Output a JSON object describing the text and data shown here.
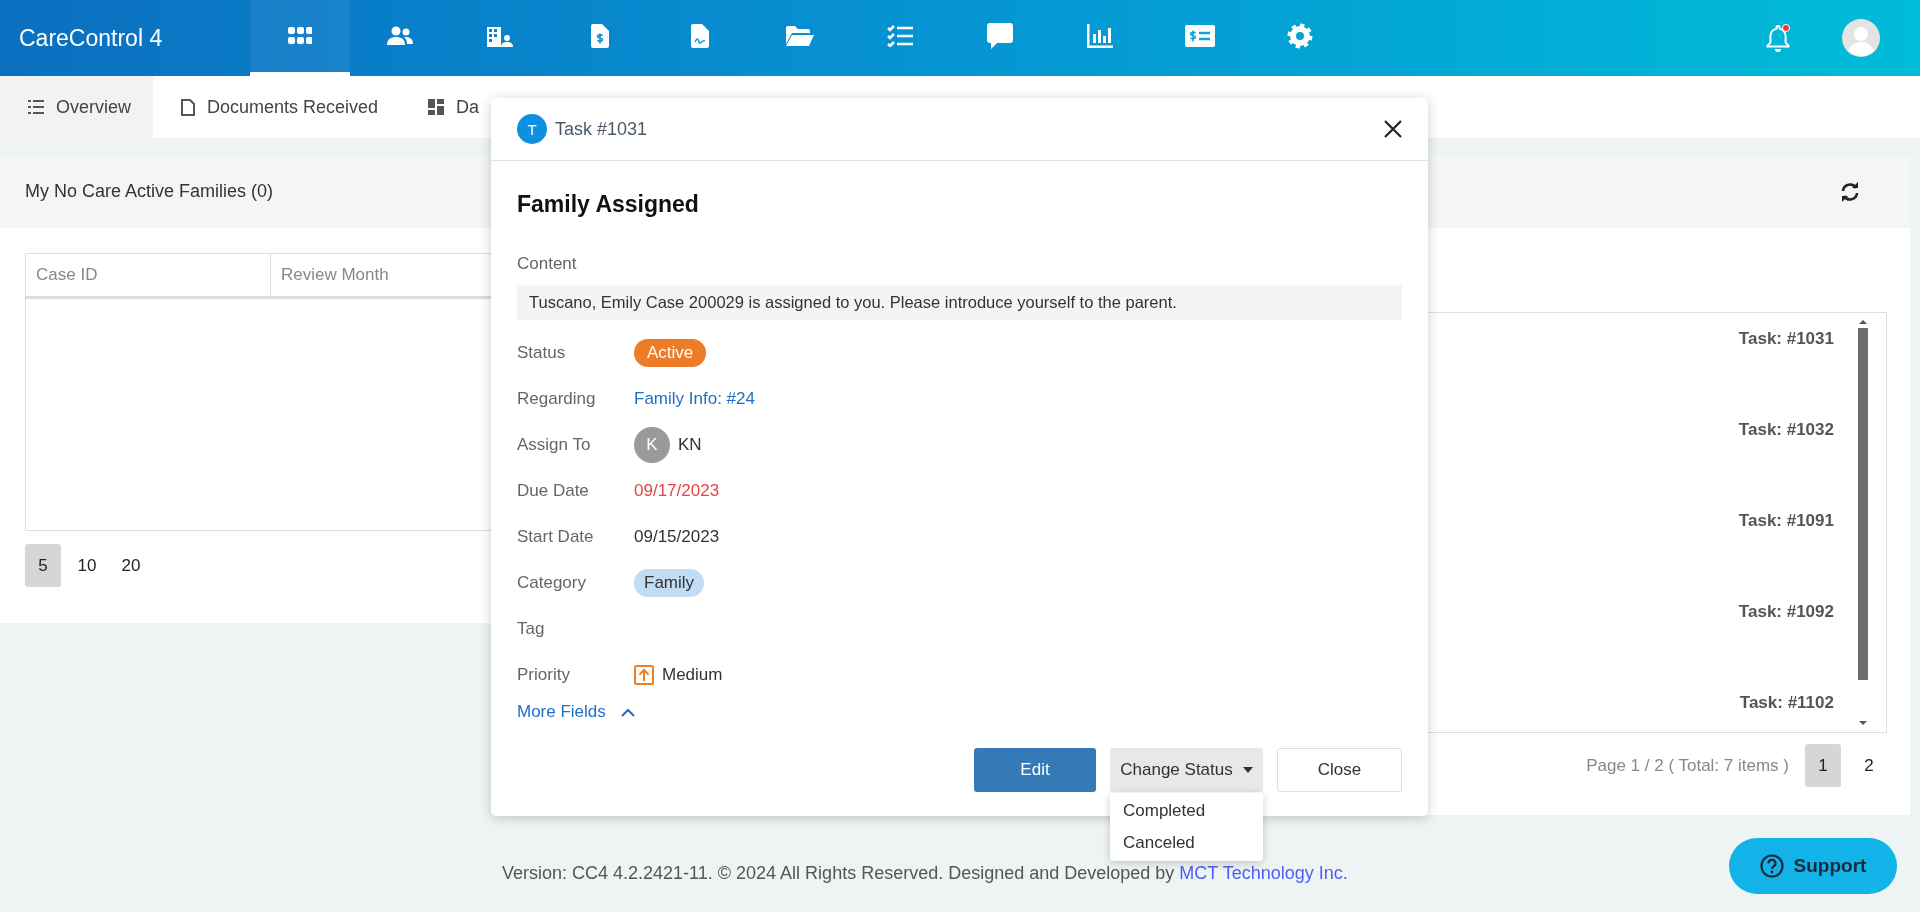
{
  "app": {
    "title": "CareControl 4"
  },
  "nav": [
    {
      "kind": "apps",
      "selected": true
    },
    {
      "kind": "people",
      "selected": false
    },
    {
      "kind": "building",
      "selected": false
    },
    {
      "kind": "invoice",
      "selected": false
    },
    {
      "kind": "document",
      "selected": false
    },
    {
      "kind": "folder",
      "selected": false
    },
    {
      "kind": "checklist",
      "selected": false
    },
    {
      "kind": "chat",
      "selected": false
    },
    {
      "kind": "chart",
      "selected": false
    },
    {
      "kind": "billing",
      "selected": false
    },
    {
      "kind": "settings",
      "selected": false
    }
  ],
  "notifications": {
    "unread": true
  },
  "tabs": [
    {
      "label": "Overview",
      "kind": "list",
      "selected": true
    },
    {
      "label": "Documents Received",
      "kind": "document",
      "selected": false
    },
    {
      "label": "Da",
      "kind": "dashboard",
      "selected": false
    }
  ],
  "families_panel": {
    "title": "My No Care Active Families (0)",
    "columns": [
      "Case ID",
      "Review Month"
    ],
    "page_sizes": [
      {
        "label": "5",
        "selected": true
      },
      {
        "label": "10",
        "selected": false
      },
      {
        "label": "20",
        "selected": false
      }
    ]
  },
  "task_list": {
    "items": [
      "Task: #1031",
      "Task: #1032",
      "Task: #1091",
      "Task: #1092",
      "Task: #1102"
    ],
    "pager_summary": "Page 1 / 2 ( Total: 7 items )",
    "pages": [
      {
        "label": "1",
        "selected": true
      },
      {
        "label": "2",
        "selected": false
      }
    ]
  },
  "dialog": {
    "avatar": "T",
    "title": "Task #1031",
    "heading": "Family Assigned",
    "content_label": "Content",
    "content": "Tuscano, Emily Case 200029 is assigned to you. Please introduce yourself to the parent.",
    "fields": [
      {
        "label": "Status",
        "kind": "badge",
        "value": "Active"
      },
      {
        "label": "Regarding",
        "kind": "link",
        "value": "Family Info: #24"
      },
      {
        "label": "Assign To",
        "kind": "user",
        "avatar": "K",
        "value": "KN"
      },
      {
        "label": "Due Date",
        "kind": "overdue",
        "value": "09/17/2023"
      },
      {
        "label": "Start Date",
        "kind": "text",
        "value": "09/15/2023"
      },
      {
        "label": "Category",
        "kind": "tag",
        "value": "Family"
      },
      {
        "label": "Tag",
        "kind": "empty"
      },
      {
        "label": "Priority",
        "kind": "priority",
        "value": "Medium"
      }
    ],
    "more_fields": {
      "label": "More Fields",
      "expanded": true
    },
    "buttons": [
      {
        "label": "Edit",
        "kind": "primary"
      },
      {
        "label": "Change Status",
        "kind": "dropdown"
      },
      {
        "label": "Close",
        "kind": "default"
      }
    ],
    "status_menu": [
      "Completed",
      "Canceled"
    ]
  },
  "footer": {
    "text": "Version: CC4 4.2.2421-11. © 2024 All Rights Reserved. Designed and Developed by",
    "link": "MCT Technology Inc."
  },
  "support": {
    "label": "Support"
  }
}
